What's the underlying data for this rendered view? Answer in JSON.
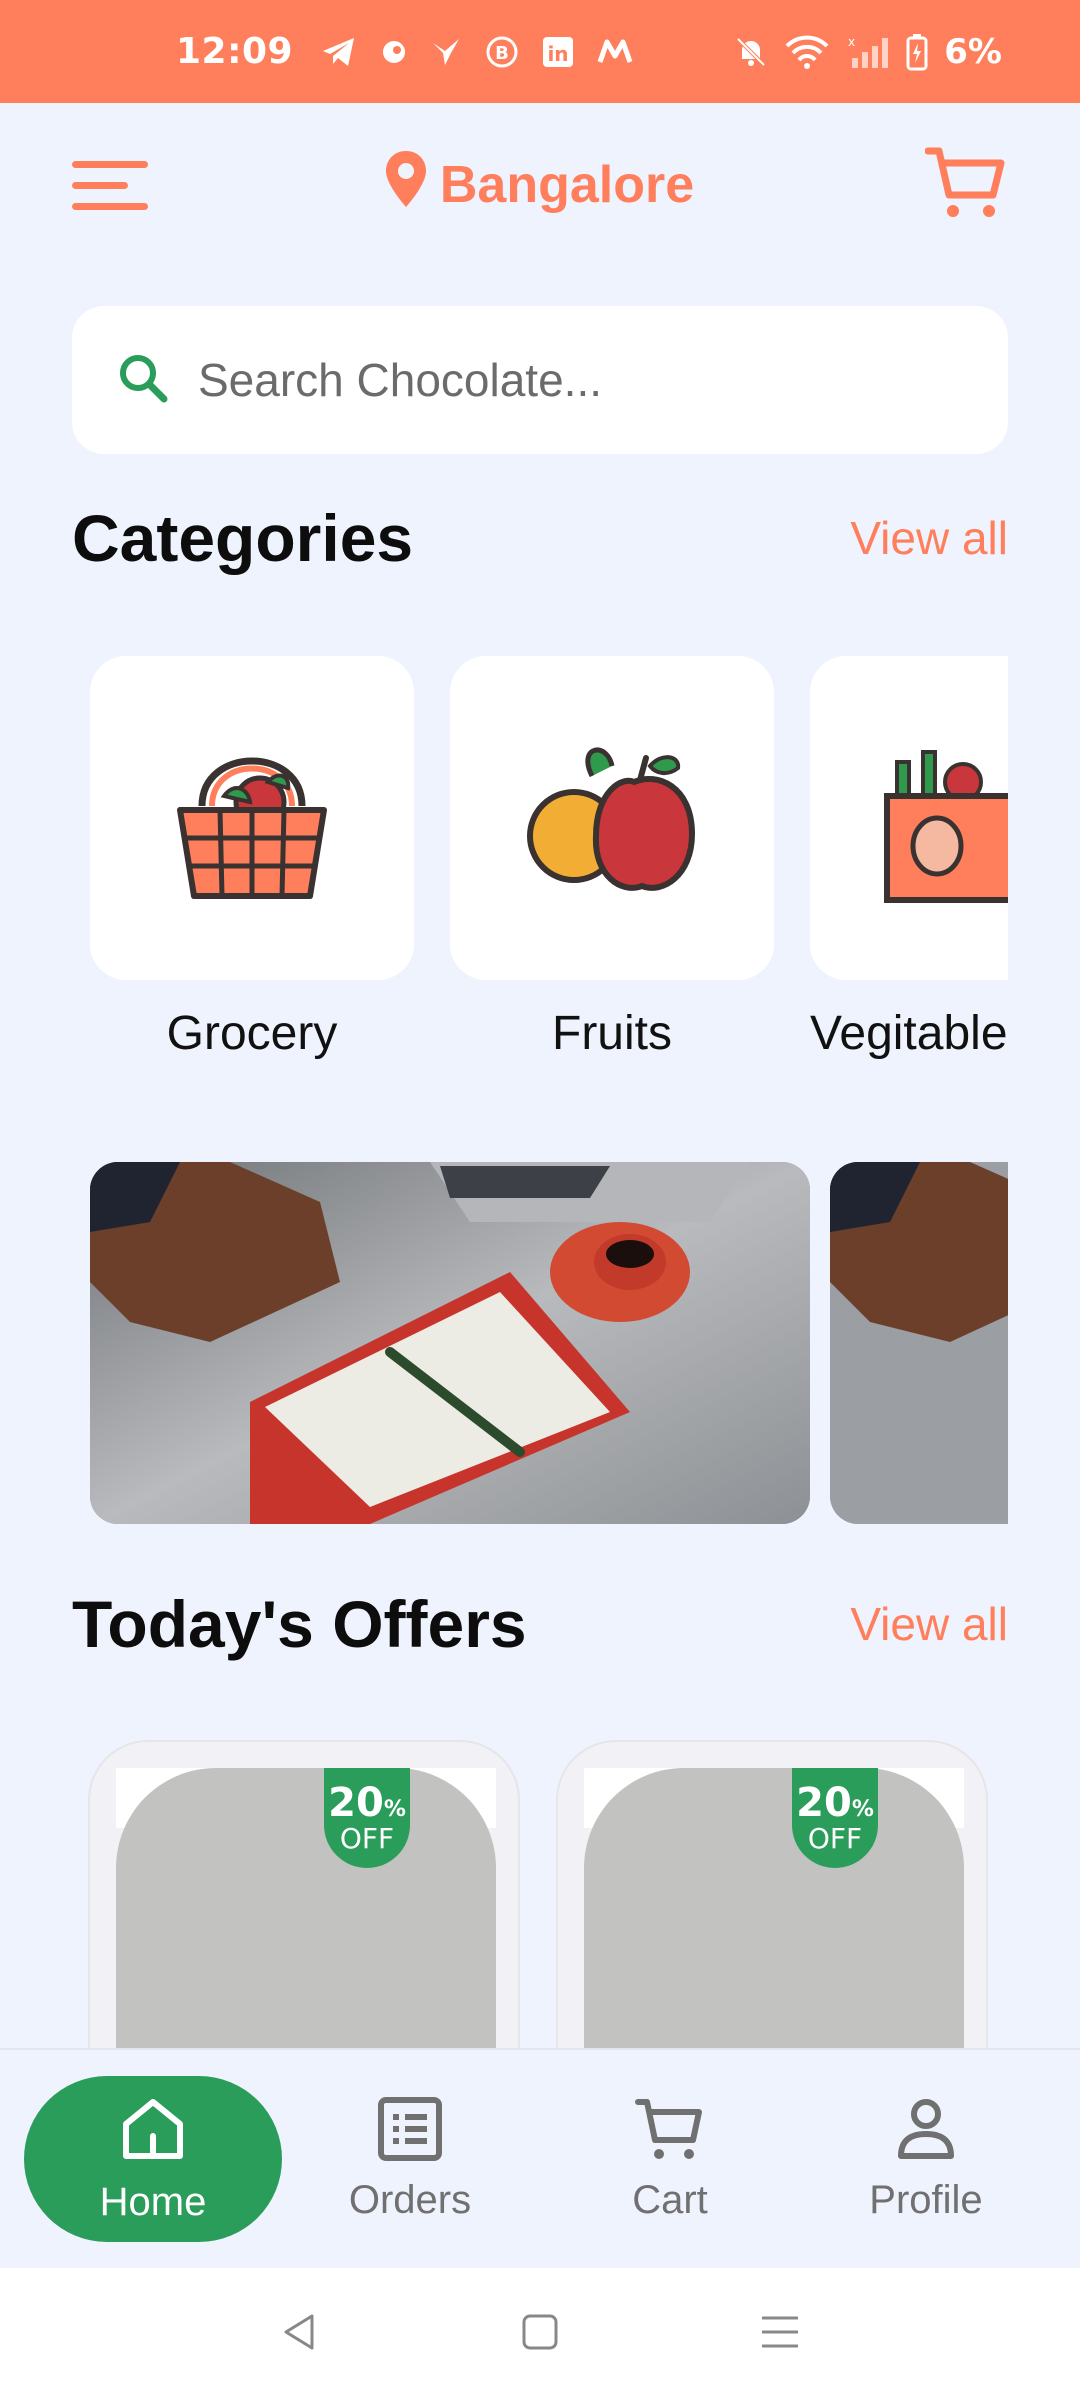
{
  "status_bar": {
    "time": "12:09",
    "battery": "6%",
    "icons_left": [
      "telegram-icon",
      "circle-app-icon",
      "bird-app-icon",
      "b-app-icon",
      "linkedin-icon",
      "m-app-icon"
    ],
    "icons_right": [
      "bell-muted-icon",
      "wifi-icon",
      "signal-icon",
      "battery-charging-icon"
    ]
  },
  "header": {
    "location": "Bangalore"
  },
  "search": {
    "placeholder": "Search Chocolate..."
  },
  "categories": {
    "title": "Categories",
    "view_all": "View all",
    "items": [
      {
        "label": "Grocery",
        "icon": "basket-icon"
      },
      {
        "label": "Fruits",
        "icon": "fruits-icon"
      },
      {
        "label": "Vegitables",
        "icon": "vegetable-bag-icon"
      }
    ]
  },
  "offers": {
    "title": "Today's Offers",
    "view_all": "View all",
    "items": [
      {
        "discount": "20",
        "unit": "%",
        "off": "OFF"
      },
      {
        "discount": "20",
        "unit": "%",
        "off": "OFF"
      }
    ]
  },
  "bottom_nav": {
    "items": [
      {
        "label": "Home",
        "icon": "home-icon",
        "active": true
      },
      {
        "label": "Orders",
        "icon": "orders-icon",
        "active": false
      },
      {
        "label": "Cart",
        "icon": "cart-icon",
        "active": false
      },
      {
        "label": "Profile",
        "icon": "profile-icon",
        "active": false
      }
    ]
  },
  "colors": {
    "accent": "#FF7F5C",
    "primary_green": "#2A9D5A",
    "background": "#EFF3FD"
  }
}
